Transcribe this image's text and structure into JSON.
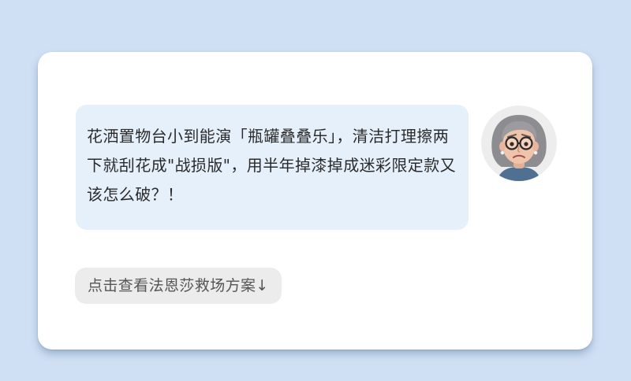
{
  "message": {
    "text": "花洒置物台小到能演「瓶罐叠叠乐」，清洁打理擦两下就刮花成\"战损版\"，用半年掉漆掉成迷彩限定款又该怎么破？！"
  },
  "avatar": {
    "icon": "worried-elderly-woman-avatar-icon"
  },
  "cta": {
    "label": "点击查看法恩莎救场方案↓"
  },
  "colors": {
    "background": "#cfe0f4",
    "bubble": "#e6f0fb",
    "card": "#ffffff",
    "cta_background": "#ececec"
  }
}
